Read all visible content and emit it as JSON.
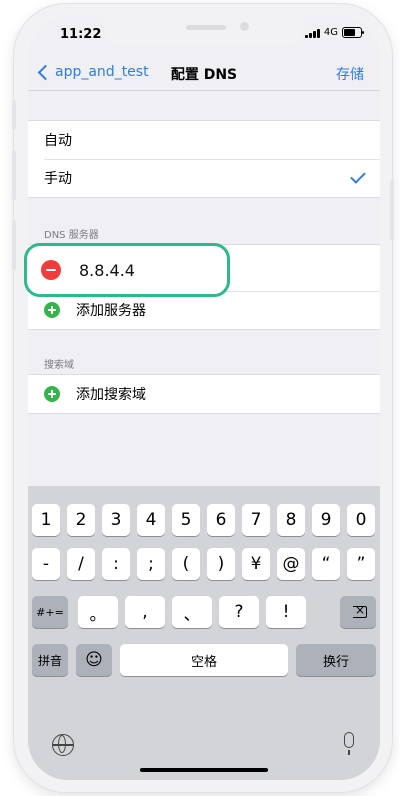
{
  "status": {
    "time": "11:22",
    "network": "4G"
  },
  "nav": {
    "back_label": "app_and_test",
    "title": "配置 DNS",
    "save_label": "存储"
  },
  "mode": {
    "options": [
      "自动",
      "手动"
    ],
    "selected": "手动"
  },
  "dns": {
    "section_label": "DNS 服务器",
    "servers": [
      "8.8.4.4"
    ],
    "add_label": "添加服务器"
  },
  "search": {
    "section_label": "搜索域",
    "add_label": "添加搜索域"
  },
  "keyboard": {
    "row1": [
      "1",
      "2",
      "3",
      "4",
      "5",
      "6",
      "7",
      "8",
      "9",
      "0"
    ],
    "row2": [
      "-",
      "/",
      ":",
      ";",
      "(",
      ")",
      "¥",
      "@",
      "“",
      "”"
    ],
    "row3_left": "#+=",
    "row3": [
      "。",
      ",",
      "、",
      "?",
      "!",
      "."
    ],
    "bottom_left": "拼音",
    "emoji": "☺",
    "space": "空格",
    "return": "换行"
  }
}
